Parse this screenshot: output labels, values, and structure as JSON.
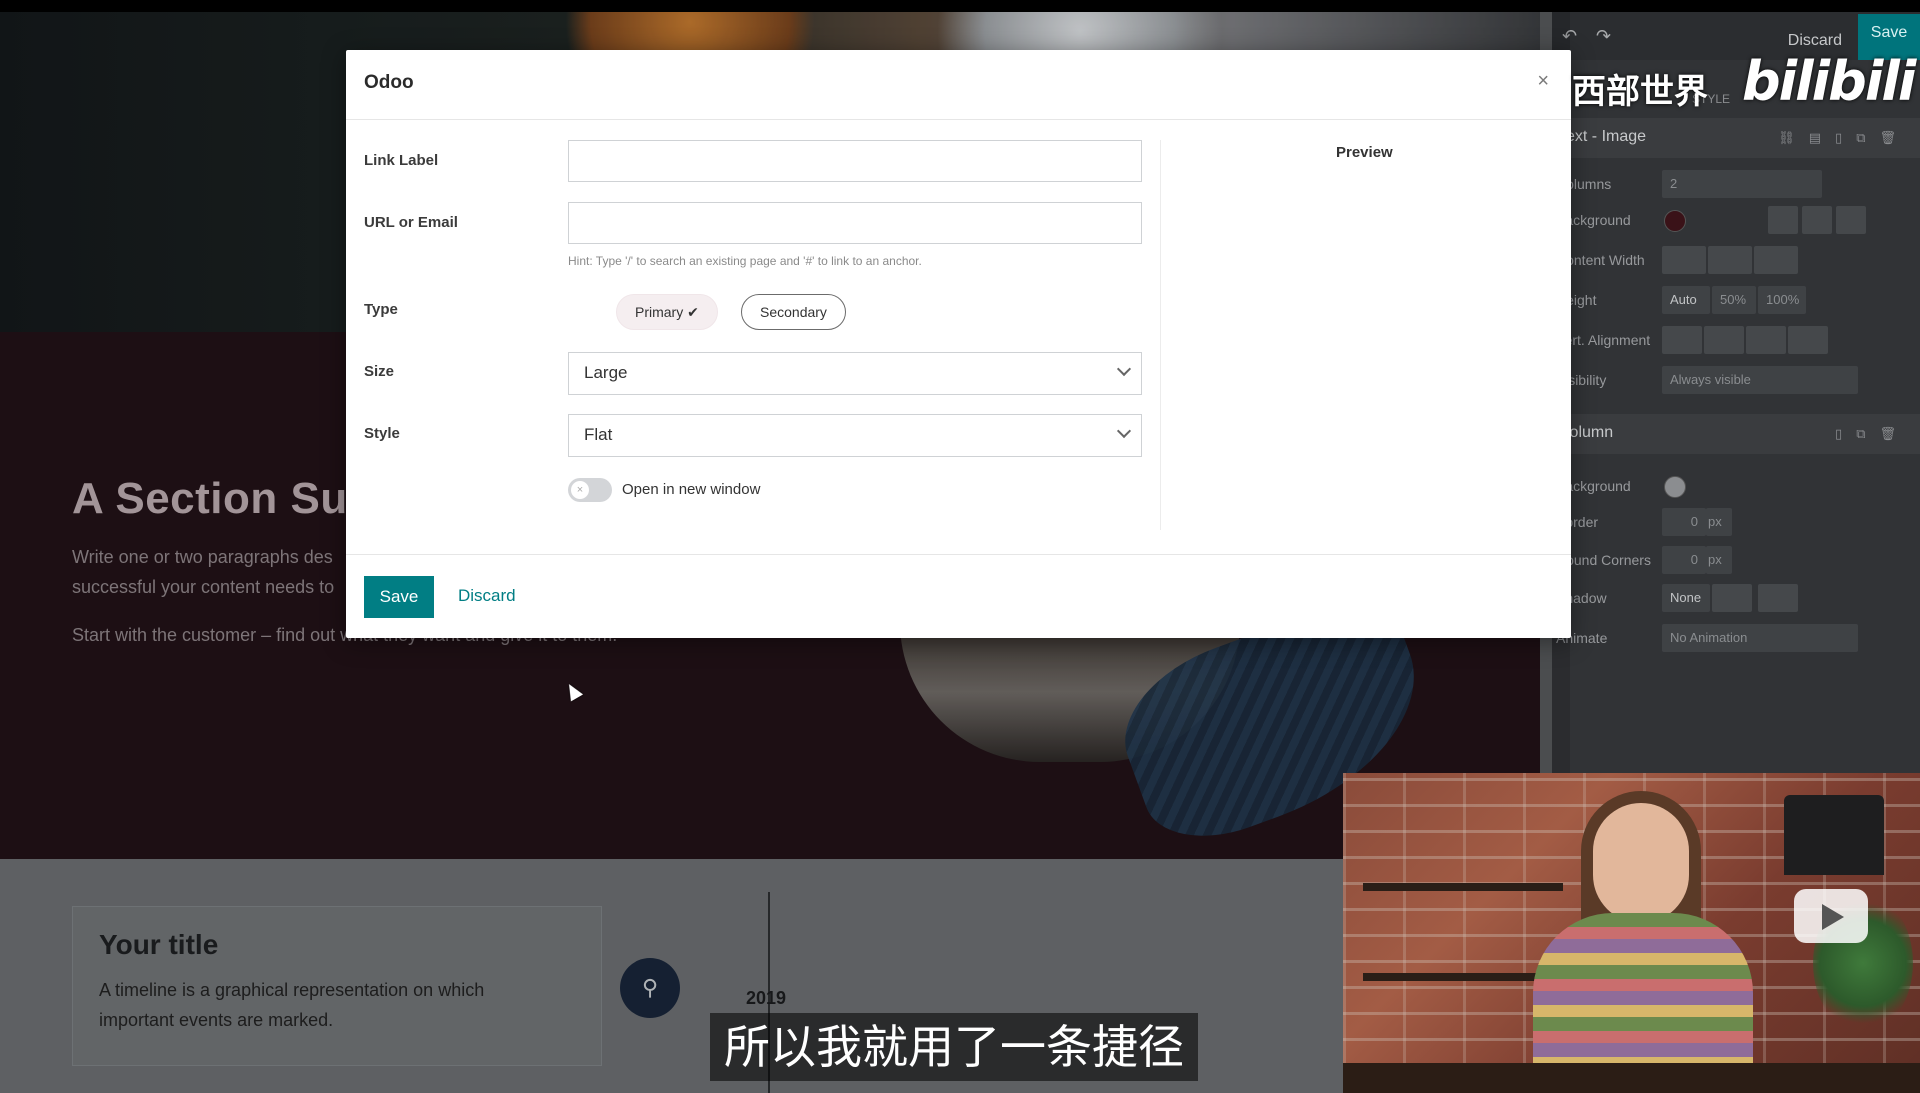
{
  "website": {
    "section_heading": "A Section Su",
    "section_para1": "Write one or two paragraphs des successful your content needs to",
    "section_para2": "Start with the customer – find out what they want and give it to them.",
    "timeline_title": "Your title",
    "timeline_text": "A timeline is a graphical representation on which important events are marked.",
    "timeline_year": "2019"
  },
  "editor_panel": {
    "discard_label": "Discard",
    "save_label": "Save",
    "tab_label": "STYLE",
    "section_text_image": "Text - Image",
    "rows_block": [
      {
        "label": "Columns",
        "value": "2"
      },
      {
        "label": "Background",
        "value": ""
      },
      {
        "label": "Content Width",
        "value": ""
      },
      {
        "label": "Height",
        "value": "Auto"
      },
      {
        "label": "Vert. Alignment",
        "value": ""
      },
      {
        "label": "Visibility",
        "value": "Always visible"
      }
    ],
    "height_options": [
      "Auto",
      "50%",
      "100%"
    ],
    "section_column": "Column",
    "rows_column": [
      {
        "label": "Background",
        "value": ""
      },
      {
        "label": "Border",
        "value": "0",
        "unit": "px"
      },
      {
        "label": "Round Corners",
        "value": "0",
        "unit": "px"
      },
      {
        "label": "Shadow",
        "value": "None"
      },
      {
        "label": "Animate",
        "value": "No Animation"
      }
    ],
    "colors": {
      "block_bg_swatch": "#3a1218",
      "column_bg_swatch": "#8b8d90"
    }
  },
  "modal": {
    "title": "Odoo",
    "close_icon": "×",
    "link_label": {
      "label": "Link Label",
      "value": "",
      "placeholder": ""
    },
    "url": {
      "label": "URL or Email",
      "value": "",
      "placeholder": "",
      "hint": "Hint: Type '/' to search an existing page and '#' to link to an anchor."
    },
    "type": {
      "label": "Type",
      "primary": "Primary ✔",
      "secondary": "Secondary"
    },
    "size": {
      "label": "Size",
      "selected": "Large"
    },
    "style": {
      "label": "Style",
      "selected": "Flat"
    },
    "new_window": {
      "label": "Open in new window",
      "checked": false
    },
    "preview_label": "Preview",
    "save_label": "Save",
    "discard_label": "Discard",
    "colors": {
      "primary": "#017e84"
    }
  },
  "overlay": {
    "watermark_cn": "西部世界",
    "watermark_logo": "bilibili",
    "subtitle": "所以我就用了一条捷径"
  }
}
